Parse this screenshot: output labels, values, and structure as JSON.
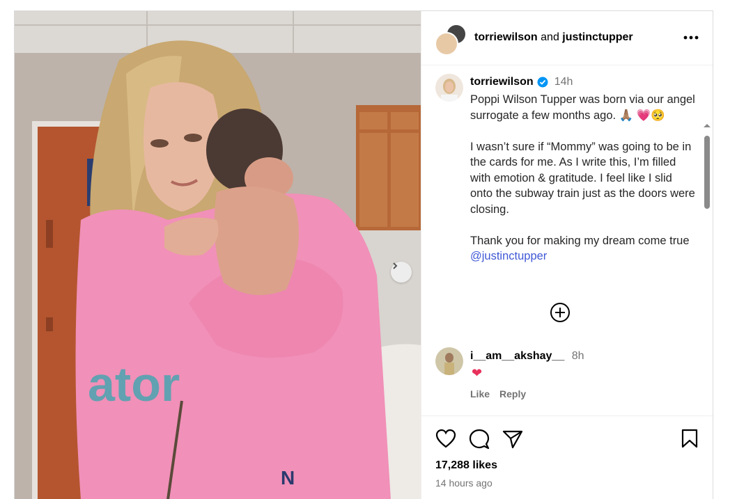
{
  "header": {
    "user1": "torriewilson",
    "joiner": "and",
    "user2": "justinctupper"
  },
  "caption": {
    "username": "torriewilson",
    "time": "14h",
    "paragraph1": "Poppi Wilson Tupper was born via our angel surrogate a few months ago. 🙏🏽 💗🥺",
    "paragraph2": "I wasn’t sure if “Mommy” was going to be in the cards for me. As I write this, I’m filled with emotion & gratitude. I feel like I slid onto the subway train just as the doors were closing.",
    "paragraph3_text": "Thank you for making my dream come true ",
    "mention": "@justinctupper"
  },
  "comment": {
    "username": "i__am__akshay__",
    "time": "8h",
    "text": "❤",
    "like_label": "Like",
    "reply_label": "Reply"
  },
  "post": {
    "likes": "17,288 likes",
    "time_ago": "14 hours ago"
  },
  "colors": {
    "mention": "#4058d6",
    "verified": "#0095f6",
    "muted": "#737373",
    "border": "#dbdbdb"
  },
  "icons": [
    "chevron-right-icon",
    "more-options-icon",
    "verified-badge-icon",
    "load-more-icon",
    "heart-icon",
    "comment-icon",
    "share-icon",
    "bookmark-icon"
  ]
}
